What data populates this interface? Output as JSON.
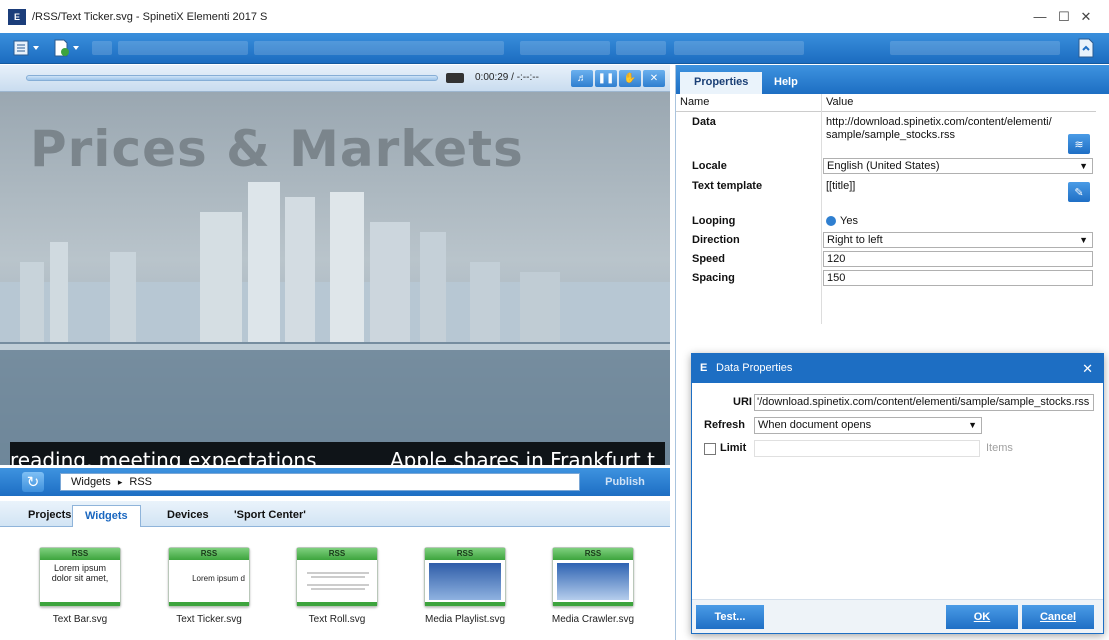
{
  "window": {
    "title": "/RSS/Text Ticker.svg - SpinetiX Elementi 2017 S",
    "app_icon": "E",
    "controls": [
      "minimize-icon",
      "maximize-icon",
      "close-icon"
    ]
  },
  "player": {
    "time": "0:00:29 / -:--:--",
    "progress": 0
  },
  "preview": {
    "heading": "Prices & Markets",
    "ticker_left": "reading, meeting expectations",
    "ticker_right": "Apple shares in Frankfurt t"
  },
  "library": {
    "path_root": "Widgets",
    "path_sep": "▸",
    "path_leaf": "RSS",
    "publish_label": "Publish",
    "tabs": [
      "Projects",
      "Widgets",
      "Devices",
      "'Sport Center'"
    ],
    "active_tab": "Widgets",
    "widgets": [
      {
        "badge": "RSS",
        "preview": "Lorem ipsum dolor sit amet,",
        "label": "Text Bar.svg"
      },
      {
        "badge": "RSS",
        "preview": "Lorem ipsum d",
        "label": "Text Ticker.svg"
      },
      {
        "badge": "RSS",
        "preview": "",
        "label": "Text Roll.svg"
      },
      {
        "badge": "RSS",
        "preview": "",
        "label": "Media Playlist.svg"
      },
      {
        "badge": "RSS",
        "preview": "",
        "label": "Media Crawler.svg"
      }
    ]
  },
  "properties": {
    "tabs": [
      "Properties",
      "Help"
    ],
    "active_tab": "Properties",
    "col_name": "Name",
    "col_value": "Value",
    "data_label": "Data",
    "data_value_line1": "http://download.spinetix.com/content/elementi/",
    "data_value_line2": "sample/sample_stocks.rss",
    "locale_label": "Locale",
    "locale_value": "English (United States)",
    "template_label": "Text template",
    "template_value": "[[title]]",
    "looping_label": "Looping",
    "looping_value": "Yes",
    "direction_label": "Direction",
    "direction_value": "Right to left",
    "speed_label": "Speed",
    "speed_value": "120",
    "spacing_label": "Spacing",
    "spacing_value": "150"
  },
  "dialog": {
    "title": "Data Properties",
    "uri_label": "URI",
    "uri_value": "'/download.spinetix.com/content/elementi/sample/sample_stocks.rss",
    "refresh_label": "Refresh",
    "refresh_value": "When document opens",
    "limit_label": "Limit",
    "limit_checked": false,
    "items_label": "Items",
    "test_label": "Test...",
    "ok_label": "OK",
    "cancel_label": "Cancel"
  }
}
